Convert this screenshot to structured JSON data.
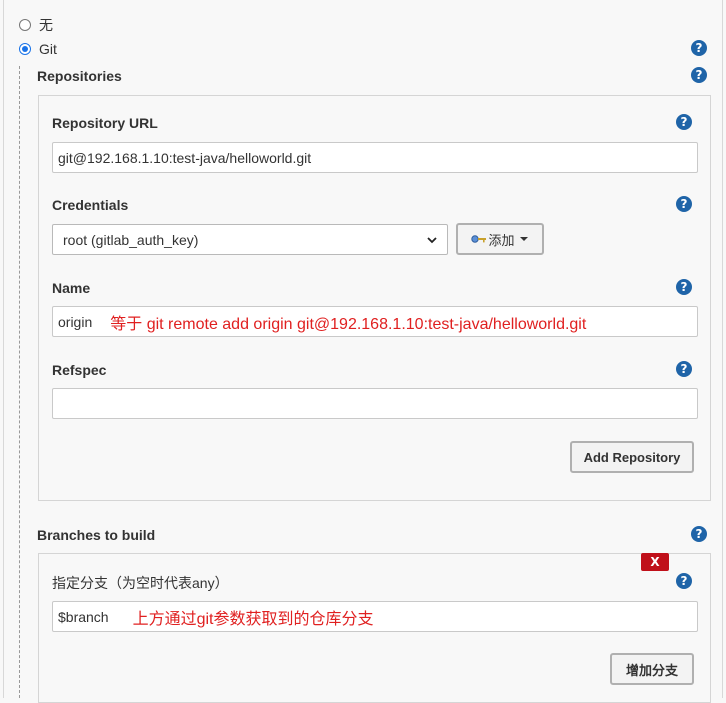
{
  "scm": {
    "options": [
      {
        "label": "无",
        "selected": false
      },
      {
        "label": "Git",
        "selected": true
      }
    ]
  },
  "repositories": {
    "section_label": "Repositories",
    "url_label": "Repository URL",
    "url_value": "git@192.168.1.10:test-java/helloworld.git",
    "credentials_label": "Credentials",
    "credentials_value": "root (gitlab_auth_key)",
    "add_button_label": "添加",
    "name_label": "Name",
    "name_value": "origin",
    "name_annotation": "等于 git remote add origin git@192.168.1.10:test-java/helloworld.git",
    "refspec_label": "Refspec",
    "refspec_value": "",
    "add_repository_label": "Add Repository"
  },
  "branches": {
    "section_label": "Branches to build",
    "delete_label": "X",
    "branch_label": "指定分支（为空时代表any）",
    "branch_value": "$branch",
    "branch_annotation": "上方通过git参数获取到的仓库分支",
    "add_branch_label": "增加分支"
  },
  "help_icon_glyph": "?",
  "colors": {
    "help_icon": "#1f64a8",
    "annotation": "#e02020",
    "delete_button": "#c0101a",
    "radio_selected": "#1a73e8"
  }
}
